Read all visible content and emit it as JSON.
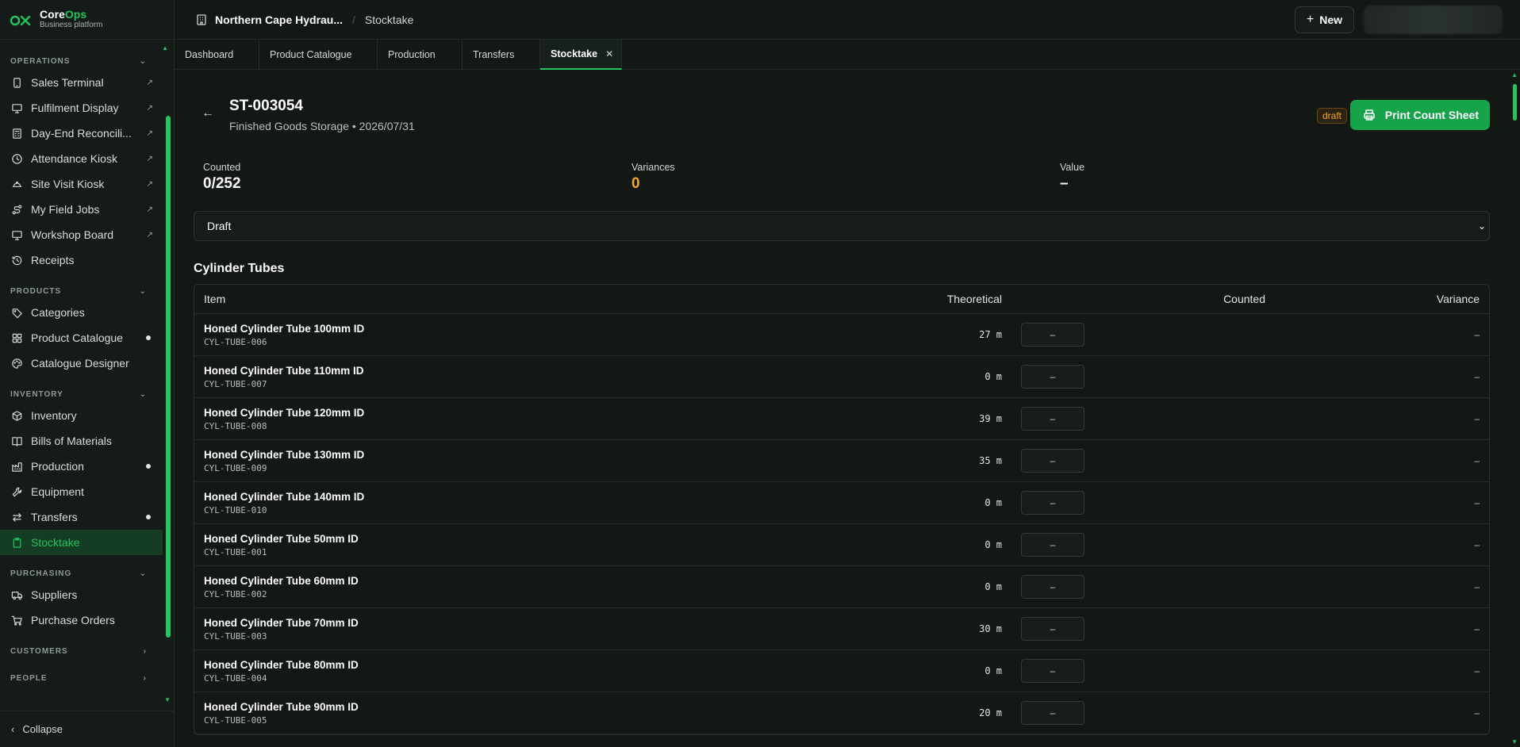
{
  "brand": {
    "name_core": "Core",
    "name_ops": "Ops",
    "subtitle": "Business platform"
  },
  "sidebar": {
    "sections": [
      {
        "title": "OPERATIONS",
        "expanded": true,
        "items": [
          {
            "label": "Sales Terminal",
            "icon": "tablet-icon",
            "external": true
          },
          {
            "label": "Fulfilment Display",
            "icon": "monitor-icon",
            "external": true
          },
          {
            "label": "Day-End Reconcili...",
            "icon": "calculator-icon",
            "external": true
          },
          {
            "label": "Attendance Kiosk",
            "icon": "clock-icon",
            "external": true
          },
          {
            "label": "Site Visit Kiosk",
            "icon": "hardhat-icon",
            "external": true
          },
          {
            "label": "My Field Jobs",
            "icon": "route-icon",
            "external": true
          },
          {
            "label": "Workshop Board",
            "icon": "monitor-icon",
            "external": true
          },
          {
            "label": "Receipts",
            "icon": "history-icon",
            "external": false
          }
        ]
      },
      {
        "title": "PRODUCTS",
        "expanded": true,
        "items": [
          {
            "label": "Categories",
            "icon": "tag-icon"
          },
          {
            "label": "Product Catalogue",
            "icon": "grid-icon",
            "dot": true
          },
          {
            "label": "Catalogue Designer",
            "icon": "palette-icon"
          }
        ]
      },
      {
        "title": "INVENTORY",
        "expanded": true,
        "items": [
          {
            "label": "Inventory",
            "icon": "box-icon"
          },
          {
            "label": "Bills of Materials",
            "icon": "book-icon"
          },
          {
            "label": "Production",
            "icon": "factory-icon",
            "dot": true
          },
          {
            "label": "Equipment",
            "icon": "wrench-icon"
          },
          {
            "label": "Transfers",
            "icon": "transfer-icon",
            "dot": true
          },
          {
            "label": "Stocktake",
            "icon": "clipboard-icon",
            "active": true
          }
        ]
      },
      {
        "title": "PURCHASING",
        "expanded": true,
        "items": [
          {
            "label": "Suppliers",
            "icon": "truck-icon"
          },
          {
            "label": "Purchase Orders",
            "icon": "cart-icon"
          }
        ]
      },
      {
        "title": "CUSTOMERS",
        "expanded": false,
        "items": []
      },
      {
        "title": "PEOPLE",
        "expanded": false,
        "items": []
      }
    ],
    "collapse_label": "Collapse"
  },
  "topbar": {
    "org": "Northern Cape Hydrau...",
    "crumb": "Stocktake",
    "new_label": "New"
  },
  "tabs": [
    {
      "label": "Dashboard"
    },
    {
      "label": "Product Catalogue"
    },
    {
      "label": "Production"
    },
    {
      "label": "Transfers"
    },
    {
      "label": "Stocktake",
      "active": true,
      "closable": true
    }
  ],
  "doc": {
    "id": "ST-003054",
    "subtitle": "Finished Goods Storage • 2026/07/31",
    "status_badge": "draft",
    "print_label": "Print Count Sheet"
  },
  "stats": {
    "counted_label": "Counted",
    "counted_value": "0/252",
    "variances_label": "Variances",
    "variances_value": "0",
    "value_label": "Value",
    "value_value": "–"
  },
  "status_select": {
    "value": "Draft"
  },
  "group": {
    "title": "Cylinder Tubes"
  },
  "table": {
    "headers": {
      "item": "Item",
      "theoretical": "Theoretical",
      "counted": "Counted",
      "variance": "Variance"
    },
    "rows": [
      {
        "name": "Honed Cylinder Tube 100mm ID",
        "sku": "CYL-TUBE-006",
        "theoretical": "27 m",
        "counted": "–",
        "variance": "–"
      },
      {
        "name": "Honed Cylinder Tube 110mm ID",
        "sku": "CYL-TUBE-007",
        "theoretical": "0 m",
        "counted": "–",
        "variance": "–"
      },
      {
        "name": "Honed Cylinder Tube 120mm ID",
        "sku": "CYL-TUBE-008",
        "theoretical": "39 m",
        "counted": "–",
        "variance": "–"
      },
      {
        "name": "Honed Cylinder Tube 130mm ID",
        "sku": "CYL-TUBE-009",
        "theoretical": "35 m",
        "counted": "–",
        "variance": "–"
      },
      {
        "name": "Honed Cylinder Tube 140mm ID",
        "sku": "CYL-TUBE-010",
        "theoretical": "0 m",
        "counted": "–",
        "variance": "–"
      },
      {
        "name": "Honed Cylinder Tube 50mm ID",
        "sku": "CYL-TUBE-001",
        "theoretical": "0 m",
        "counted": "–",
        "variance": "–"
      },
      {
        "name": "Honed Cylinder Tube 60mm ID",
        "sku": "CYL-TUBE-002",
        "theoretical": "0 m",
        "counted": "–",
        "variance": "–"
      },
      {
        "name": "Honed Cylinder Tube 70mm ID",
        "sku": "CYL-TUBE-003",
        "theoretical": "30 m",
        "counted": "–",
        "variance": "–"
      },
      {
        "name": "Honed Cylinder Tube 80mm ID",
        "sku": "CYL-TUBE-004",
        "theoretical": "0 m",
        "counted": "–",
        "variance": "–"
      },
      {
        "name": "Honed Cylinder Tube 90mm ID",
        "sku": "CYL-TUBE-005",
        "theoretical": "20 m",
        "counted": "–",
        "variance": "–"
      }
    ]
  },
  "colors": {
    "accent": "#22c55e",
    "warning": "#f5a623",
    "background": "#131815"
  }
}
